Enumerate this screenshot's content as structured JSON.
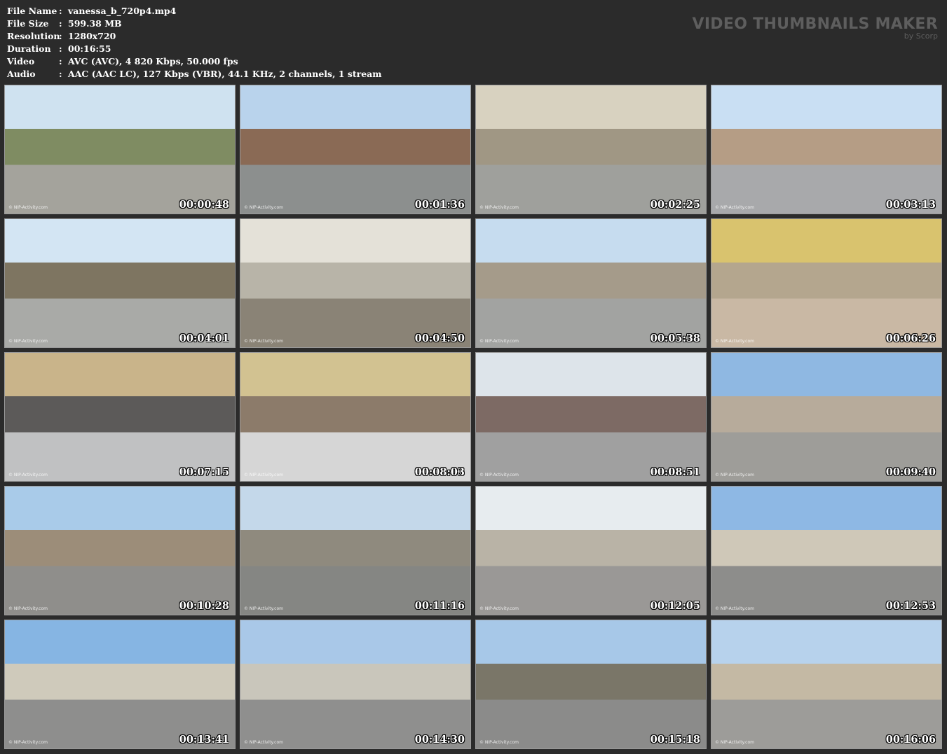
{
  "file_info": [
    {
      "label": "File Name",
      "value": "vanessa_b_720p4.mp4"
    },
    {
      "label": "File Size",
      "value": "599.38 MB"
    },
    {
      "label": "Resolution",
      "value": "1280x720"
    },
    {
      "label": "Duration",
      "value": "00:16:55"
    },
    {
      "label": "Video",
      "value": "AVC (AVC), 4 820 Kbps, 50.000 fps"
    },
    {
      "label": "Audio",
      "value": "AAC (AAC LC), 127 Kbps (VBR), 44.1 KHz, 2 channels, 1 stream"
    }
  ],
  "separator": ":",
  "brand": {
    "title": "VIDEO THUMBNAILS MAKER",
    "subtitle": "by Scorp"
  },
  "thumbnails": [
    {
      "timestamp": "00:00:48",
      "watermark": "© NIP-Activity.com",
      "colors": [
        "#cfe2f0",
        "#7f8c62",
        "#a4a39c"
      ]
    },
    {
      "timestamp": "00:01:36",
      "watermark": "© NIP-Activity.com",
      "colors": [
        "#b9d3ec",
        "#8a6a55",
        "#8c8f8e"
      ]
    },
    {
      "timestamp": "00:02:25",
      "watermark": "© NIP-Activity.com",
      "colors": [
        "#d8d2c0",
        "#a09784",
        "#9fa09c"
      ]
    },
    {
      "timestamp": "00:03:13",
      "watermark": "© NIP-Activity.com",
      "colors": [
        "#c9dff3",
        "#b59d85",
        "#a8a9ab"
      ]
    },
    {
      "timestamp": "00:04:01",
      "watermark": "© NIP-Activity.com",
      "colors": [
        "#d3e5f3",
        "#7e7561",
        "#a9aaa7"
      ]
    },
    {
      "timestamp": "00:04:50",
      "watermark": "© NIP-Activity.com",
      "colors": [
        "#e4e1d8",
        "#b8b4a8",
        "#8a8376"
      ]
    },
    {
      "timestamp": "00:05:38",
      "watermark": "© NIP-Activity.com",
      "colors": [
        "#c6dcef",
        "#a59b8a",
        "#a2a3a1"
      ]
    },
    {
      "timestamp": "00:06:26",
      "watermark": "© NIP-Activity.com",
      "colors": [
        "#d9c36e",
        "#b4a68e",
        "#c9b8a4"
      ]
    },
    {
      "timestamp": "00:07:15",
      "watermark": "© NIP-Activity.com",
      "colors": [
        "#c9b48a",
        "#5c5a59",
        "#c0c1c2"
      ]
    },
    {
      "timestamp": "00:08:03",
      "watermark": "© NIP-Activity.com",
      "colors": [
        "#d2c291",
        "#8c7b6a",
        "#d6d6d6"
      ]
    },
    {
      "timestamp": "00:08:51",
      "watermark": "© NIP-Activity.com",
      "colors": [
        "#dde4ea",
        "#7d6a64",
        "#a0a0a0"
      ]
    },
    {
      "timestamp": "00:09:40",
      "watermark": "© NIP-Activity.com",
      "colors": [
        "#8fb8e2",
        "#b7ab9b",
        "#9e9d99"
      ]
    },
    {
      "timestamp": "00:10:28",
      "watermark": "© NIP-Activity.com",
      "colors": [
        "#a9cbe9",
        "#9c8d79",
        "#8f8e8b"
      ]
    },
    {
      "timestamp": "00:11:16",
      "watermark": "© NIP-Activity.com",
      "colors": [
        "#c4d8ea",
        "#8f8a7e",
        "#858683"
      ]
    },
    {
      "timestamp": "00:12:05",
      "watermark": "© NIP-Activity.com",
      "colors": [
        "#e7ecef",
        "#b9b3a6",
        "#9a9896"
      ]
    },
    {
      "timestamp": "00:12:53",
      "watermark": "© NIP-Activity.com",
      "colors": [
        "#8eb8e4",
        "#cfc8b8",
        "#8d8d8b"
      ]
    },
    {
      "timestamp": "00:13:41",
      "watermark": "© NIP-Activity.com",
      "colors": [
        "#86b5e3",
        "#cfcabb",
        "#8e8e8d"
      ]
    },
    {
      "timestamp": "00:14:30",
      "watermark": "© NIP-Activity.com",
      "colors": [
        "#a9c8e8",
        "#c9c6bb",
        "#8f8f8e"
      ]
    },
    {
      "timestamp": "00:15:18",
      "watermark": "© NIP-Activity.com",
      "colors": [
        "#a7c8e8",
        "#7a7668",
        "#8b8b8a"
      ]
    },
    {
      "timestamp": "00:16:06",
      "watermark": "© NIP-Activity.com",
      "colors": [
        "#b7d2ec",
        "#c4b9a4",
        "#9d9c99"
      ]
    }
  ]
}
